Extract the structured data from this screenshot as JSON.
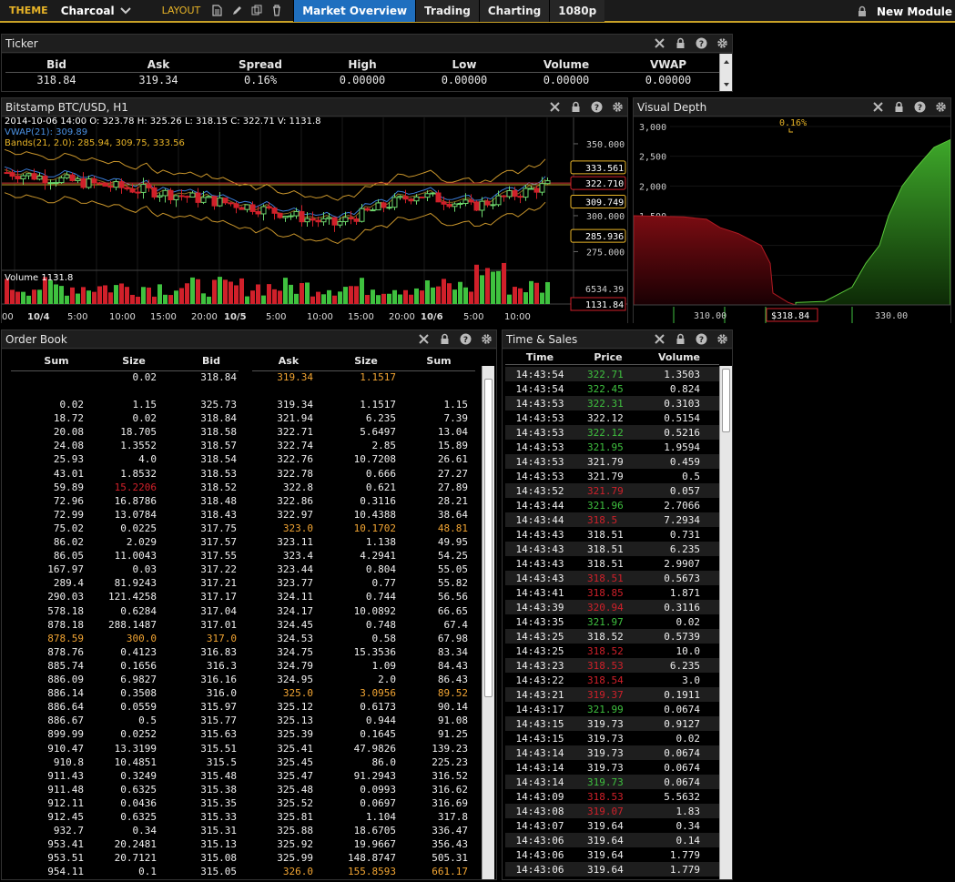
{
  "topbar": {
    "theme_label": "THEME",
    "theme_value": "Charcoal",
    "layout_label": "LAYOUT",
    "tabs": [
      "Market Overview",
      "Trading",
      "Charting",
      "1080p"
    ],
    "new_module": "New Module"
  },
  "ticker": {
    "title": "Ticker",
    "headers": [
      "Bid",
      "Ask",
      "Spread",
      "High",
      "Low",
      "Volume",
      "VWAP"
    ],
    "values": [
      "318.84",
      "319.34",
      "0.16%",
      "0.00000",
      "0.00000",
      "0.00000",
      "0.00000"
    ]
  },
  "chart": {
    "title": "Bitstamp BTC/USD, H1",
    "ohlc": "2014-10-06 14:00   O: 323.78 H: 325.26 L: 318.15 C: 322.71 V: 1131.8",
    "vwap": "VWAP(21): 309.89",
    "bands": "Bands(21, 2.0): 285.94, 309.75, 333.56",
    "volume_label": "Volume 1131.8",
    "price_ticks": [
      "350.000",
      "325.000",
      "300.000",
      "275.000"
    ],
    "price_tags": [
      "333.561",
      "322.710",
      "309.749",
      "285.936"
    ],
    "vol_tick": "6534.39",
    "vol_tag": "1131.84",
    "time_ticks": [
      "00",
      "10/4",
      "5:00",
      "10:00",
      "15:00",
      "20:00",
      "10/5",
      "5:00",
      "10:00",
      "15:00",
      "20:00",
      "10/6",
      "5:00",
      "10:00"
    ]
  },
  "depth": {
    "title": "Visual Depth",
    "spread": "0.16%",
    "y_ticks": [
      "3,000",
      "2,500",
      "2,000",
      "1,500",
      "1,000",
      "500"
    ],
    "x_ticks": [
      "310.00",
      "$318.84",
      "330.00"
    ]
  },
  "orderbook": {
    "title": "Order Book",
    "headers": [
      "Sum",
      "Size",
      "Bid",
      "Ask",
      "Size",
      "Sum"
    ],
    "top": {
      "size": "0.02",
      "bid": "318.84",
      "ask": "319.34",
      "asize": "1.1517"
    },
    "rows": [
      [
        "0.02",
        "1.15",
        "325.73",
        "319.34",
        "1.1517",
        "1.15"
      ],
      [
        "18.72",
        "0.02",
        "318.84",
        "321.94",
        "6.235",
        "7.39"
      ],
      [
        "20.08",
        "18.705",
        "318.58",
        "322.71",
        "5.6497",
        "13.04"
      ],
      [
        "24.08",
        "1.3552",
        "318.57",
        "322.74",
        "2.85",
        "15.89"
      ],
      [
        "25.93",
        "4.0",
        "318.54",
        "322.76",
        "10.7208",
        "26.61"
      ],
      [
        "43.01",
        "1.8532",
        "318.53",
        "322.78",
        "0.666",
        "27.27"
      ],
      [
        "59.89",
        "15.2206",
        "318.52",
        "322.8",
        "0.621",
        "27.89"
      ],
      [
        "72.96",
        "16.8786",
        "318.48",
        "322.86",
        "0.3116",
        "28.21"
      ],
      [
        "72.99",
        "13.0784",
        "318.43",
        "322.97",
        "10.4388",
        "38.64"
      ],
      [
        "75.02",
        "0.0225",
        "317.75",
        "323.0",
        "10.1702",
        "48.81"
      ],
      [
        "86.02",
        "2.029",
        "317.57",
        "323.11",
        "1.138",
        "49.95"
      ],
      [
        "86.05",
        "11.0043",
        "317.55",
        "323.4",
        "4.2941",
        "54.25"
      ],
      [
        "167.97",
        "0.03",
        "317.22",
        "323.44",
        "0.804",
        "55.05"
      ],
      [
        "289.4",
        "81.9243",
        "317.21",
        "323.77",
        "0.77",
        "55.82"
      ],
      [
        "290.03",
        "121.4258",
        "317.17",
        "324.11",
        "0.744",
        "56.56"
      ],
      [
        "578.18",
        "0.6284",
        "317.04",
        "324.17",
        "10.0892",
        "66.65"
      ],
      [
        "878.18",
        "288.1487",
        "317.01",
        "324.45",
        "0.748",
        "67.4"
      ],
      [
        "878.59",
        "300.0",
        "317.0",
        "324.53",
        "0.58",
        "67.98"
      ],
      [
        "878.76",
        "0.4123",
        "316.83",
        "324.75",
        "15.3536",
        "83.34"
      ],
      [
        "885.74",
        "0.1656",
        "316.3",
        "324.79",
        "1.09",
        "84.43"
      ],
      [
        "886.09",
        "6.9827",
        "316.16",
        "324.95",
        "2.0",
        "86.43"
      ],
      [
        "886.14",
        "0.3508",
        "316.0",
        "325.0",
        "3.0956",
        "89.52"
      ],
      [
        "886.64",
        "0.0559",
        "315.97",
        "325.12",
        "0.6173",
        "90.14"
      ],
      [
        "886.67",
        "0.5",
        "315.77",
        "325.13",
        "0.944",
        "91.08"
      ],
      [
        "899.99",
        "0.0252",
        "315.63",
        "325.39",
        "0.1645",
        "91.25"
      ],
      [
        "910.47",
        "13.3199",
        "315.51",
        "325.41",
        "47.9826",
        "139.23"
      ],
      [
        "910.8",
        "10.4851",
        "315.5",
        "325.45",
        "86.0",
        "225.23"
      ],
      [
        "911.43",
        "0.3249",
        "315.48",
        "325.47",
        "91.2943",
        "316.52"
      ],
      [
        "911.48",
        "0.6325",
        "315.38",
        "325.48",
        "0.0993",
        "316.62"
      ],
      [
        "912.11",
        "0.0436",
        "315.35",
        "325.52",
        "0.0697",
        "316.69"
      ],
      [
        "912.45",
        "0.6325",
        "315.33",
        "325.81",
        "1.104",
        "317.8"
      ],
      [
        "932.7",
        "0.34",
        "315.31",
        "325.88",
        "18.6705",
        "336.47"
      ],
      [
        "953.41",
        "20.2481",
        "315.13",
        "325.92",
        "19.9667",
        "356.43"
      ],
      [
        "953.51",
        "20.7121",
        "315.08",
        "325.99",
        "148.8747",
        "505.31"
      ],
      [
        "954.11",
        "0.1",
        "315.05",
        "326.0",
        "155.8593",
        "661.17"
      ]
    ]
  },
  "sales": {
    "title": "Time & Sales",
    "headers": [
      "Time",
      "Price",
      "Volume"
    ],
    "rows": [
      [
        "14:43:54",
        "322.71",
        "1.3503",
        "g"
      ],
      [
        "14:43:54",
        "322.45",
        "0.824",
        "g"
      ],
      [
        "14:43:53",
        "322.31",
        "0.3103",
        "g"
      ],
      [
        "14:43:53",
        "322.12",
        "0.5154",
        "w"
      ],
      [
        "14:43:53",
        "322.12",
        "0.5216",
        "g"
      ],
      [
        "14:43:53",
        "321.95",
        "1.9594",
        "g"
      ],
      [
        "14:43:53",
        "321.79",
        "0.459",
        "w"
      ],
      [
        "14:43:53",
        "321.79",
        "0.5",
        "w"
      ],
      [
        "14:43:52",
        "321.79",
        "0.057",
        "r"
      ],
      [
        "14:43:44",
        "321.96",
        "2.7066",
        "g"
      ],
      [
        "14:43:44",
        "318.5",
        "7.2934",
        "r"
      ],
      [
        "14:43:43",
        "318.51",
        "0.731",
        "w"
      ],
      [
        "14:43:43",
        "318.51",
        "6.235",
        "w"
      ],
      [
        "14:43:43",
        "318.51",
        "2.9907",
        "w"
      ],
      [
        "14:43:43",
        "318.51",
        "0.5673",
        "r"
      ],
      [
        "14:43:41",
        "318.85",
        "1.871",
        "r"
      ],
      [
        "14:43:39",
        "320.94",
        "0.3116",
        "r"
      ],
      [
        "14:43:35",
        "321.97",
        "0.02",
        "g"
      ],
      [
        "14:43:25",
        "318.52",
        "0.5739",
        "w"
      ],
      [
        "14:43:25",
        "318.52",
        "10.0",
        "r"
      ],
      [
        "14:43:23",
        "318.53",
        "6.235",
        "r"
      ],
      [
        "14:43:22",
        "318.54",
        "3.0",
        "r"
      ],
      [
        "14:43:21",
        "319.37",
        "0.1911",
        "r"
      ],
      [
        "14:43:17",
        "321.99",
        "0.0674",
        "g"
      ],
      [
        "14:43:15",
        "319.73",
        "0.9127",
        "w"
      ],
      [
        "14:43:15",
        "319.73",
        "0.02",
        "w"
      ],
      [
        "14:43:14",
        "319.73",
        "0.0674",
        "w"
      ],
      [
        "14:43:14",
        "319.73",
        "0.0674",
        "w"
      ],
      [
        "14:43:14",
        "319.73",
        "0.0674",
        "g"
      ],
      [
        "14:43:09",
        "318.53",
        "5.5632",
        "r"
      ],
      [
        "14:43:08",
        "319.07",
        "1.83",
        "r"
      ],
      [
        "14:43:07",
        "319.64",
        "0.34",
        "w"
      ],
      [
        "14:43:06",
        "319.64",
        "0.14",
        "w"
      ],
      [
        "14:43:06",
        "319.64",
        "1.779",
        "w"
      ],
      [
        "14:43:06",
        "319.64",
        "1.779",
        "w"
      ]
    ]
  },
  "colors": {
    "accent": "#e8b427",
    "tab_active": "#1f6fbf",
    "up": "#3fc13f",
    "down": "#d0202a",
    "highlight": "#f2a533"
  }
}
